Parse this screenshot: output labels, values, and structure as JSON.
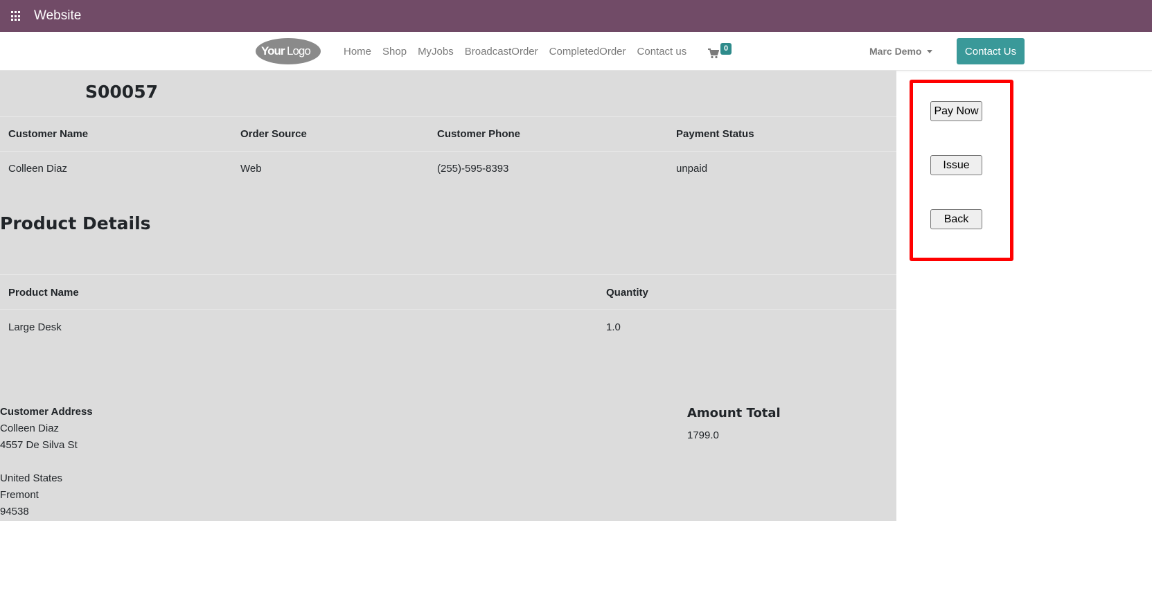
{
  "topbar": {
    "title": "Website"
  },
  "logo": {
    "text_your": "Your",
    "text_logo": "Logo"
  },
  "nav": {
    "links": [
      "Home",
      "Shop",
      "MyJobs",
      "BroadcastOrder",
      "CompletedOrder",
      "Contact us"
    ],
    "cart_count": "0",
    "user": "Marc Demo",
    "contact_button": "Contact Us"
  },
  "order": {
    "number": "S00057",
    "headers": [
      "Customer Name",
      "Order Source",
      "Customer Phone",
      "Payment Status"
    ],
    "values": [
      "Colleen Diaz",
      "Web",
      "(255)-595-8393",
      "unpaid"
    ]
  },
  "products": {
    "heading": "Product Details",
    "headers": [
      "Product Name",
      "Quantity"
    ],
    "rows": [
      [
        "Large Desk",
        "1.0"
      ]
    ]
  },
  "address": {
    "label": "Customer Address",
    "lines": [
      "Colleen Diaz",
      "4557 De Silva St",
      "",
      "United States",
      "Fremont",
      "94538"
    ]
  },
  "amount": {
    "label": "Amount Total",
    "value": "1799.0"
  },
  "actions": {
    "pay_now": "Pay Now",
    "issue": "Issue",
    "back": "Back"
  },
  "colors": {
    "topbar": "#714b67",
    "accent": "#3a9999",
    "highlight": "#ff0000",
    "panel": "#dcdcdc"
  }
}
